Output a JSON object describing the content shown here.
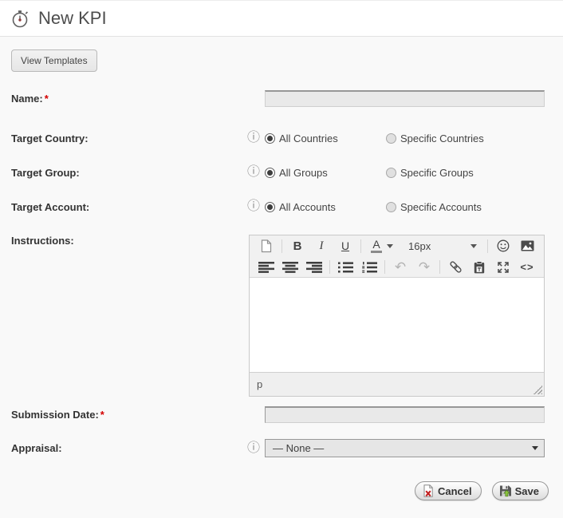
{
  "header": {
    "title": "New KPI",
    "icon": "stopwatch-icon"
  },
  "actions_top": {
    "view_templates": "View Templates"
  },
  "form": {
    "required_marker": "*",
    "name": {
      "label": "Name:",
      "required": true,
      "value": ""
    },
    "target_country": {
      "label": "Target Country:",
      "option_all": "All Countries",
      "option_specific": "Specific Countries",
      "selected": "All Countries"
    },
    "target_group": {
      "label": "Target Group:",
      "option_all": "All Groups",
      "option_specific": "Specific Groups",
      "selected": "All Groups"
    },
    "target_account": {
      "label": "Target Account:",
      "option_all": "All Accounts",
      "option_specific": "Specific Accounts",
      "selected": "All Accounts"
    },
    "instructions": {
      "label": "Instructions:",
      "editor": {
        "bold": "B",
        "italic": "I",
        "underline": "U",
        "font_color": "A",
        "font_size": "16px",
        "code_view": "<>",
        "status": "p",
        "toolbar_icons": [
          "new-document",
          "bold",
          "italic",
          "underline",
          "font-color",
          "font-size",
          "emoticons",
          "insert-image",
          "align-left",
          "align-center",
          "align-right",
          "unordered-list",
          "ordered-list",
          "undo",
          "redo",
          "insert-link",
          "paste",
          "fullscreen",
          "code-view"
        ]
      }
    },
    "submission_date": {
      "label": "Submission Date:",
      "required": true,
      "value": ""
    },
    "appraisal": {
      "label": "Appraisal:",
      "selected_option": "— None —"
    }
  },
  "footer": {
    "cancel": "Cancel",
    "save": "Save"
  },
  "colors": {
    "label_text": "#333333",
    "required_red": "#d40000",
    "input_bg": "#e9e9e9",
    "cancel_x_red": "#cc2222",
    "save_arrow_green": "#8dc63f"
  }
}
